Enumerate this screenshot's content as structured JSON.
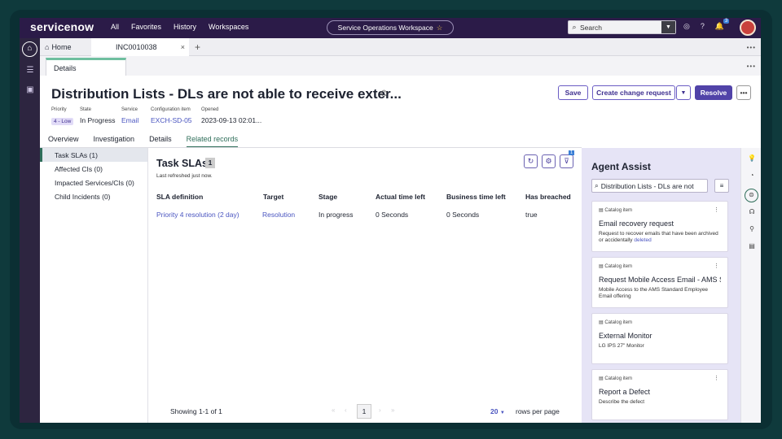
{
  "topbar": {
    "logo": "servicenow",
    "nav": [
      "All",
      "Favorites",
      "History",
      "Workspaces"
    ],
    "workspace": "Service Operations Workspace",
    "search_placeholder": "Search",
    "notification_count": "3"
  },
  "tabs": {
    "home": "Home",
    "record": "INC0010038"
  },
  "subtab": "Details",
  "record": {
    "title": "Distribution Lists - DLs are not able to receive exter...",
    "fields": {
      "priority_label": "Priority",
      "priority_value": "4 - Low",
      "state_label": "State",
      "state_value": "In Progress",
      "service_label": "Service",
      "service_value": "Email",
      "ci_label": "Configuration item",
      "ci_value": "EXCH-SD-05",
      "opened_label": "Opened",
      "opened_value": "2023-09-13 02:01..."
    },
    "buttons": {
      "save": "Save",
      "create_change": "Create change request",
      "resolve": "Resolve"
    },
    "tabs": [
      "Overview",
      "Investigation",
      "Details",
      "Related records"
    ]
  },
  "related_list": [
    "Task SLAs (1)",
    "Affected CIs (0)",
    "Impacted Services/CIs (0)",
    "Child Incidents (0)"
  ],
  "task_slas": {
    "title": "Task SLAs",
    "count": "1",
    "refreshed": "Last refreshed just now.",
    "filter_badge": "1",
    "columns": [
      "SLA definition",
      "Target",
      "Stage",
      "Actual time left",
      "Business time left",
      "Has breached"
    ],
    "rows": [
      [
        "Priority 4 resolution (2 day)",
        "Resolution",
        "In progress",
        "0 Seconds",
        "0 Seconds",
        "true"
      ]
    ],
    "pager": {
      "showing": "Showing 1-1 of 1",
      "page": "1",
      "per_page": "20",
      "per_page_label": "rows per page"
    }
  },
  "agent_assist": {
    "title": "Agent Assist",
    "search_value": "Distribution Lists - DLs are not",
    "cards": [
      {
        "type": "Catalog item",
        "title": "Email recovery request",
        "desc": "Request to recover emails that have been archived or accidentally ",
        "desc_hl": "deleted"
      },
      {
        "type": "Catalog item",
        "title": "Request Mobile Access Email - AMS S...",
        "desc": "Mobile Access to the AMS Standard Employee Email offering",
        "desc_hl": ""
      },
      {
        "type": "Catalog item",
        "title": "External Monitor",
        "desc": "LG IPS 27\" Monitor",
        "desc_hl": ""
      },
      {
        "type": "Catalog item",
        "title": "Report a Defect",
        "desc": "Describe the defect",
        "desc_hl": ""
      }
    ]
  },
  "colors": {
    "topbar": "#2b1b48",
    "primary_button": "#5143a8",
    "link": "#4a55c0",
    "active_tab": "#2f6e5a",
    "assist_bg": "#e6e4f6"
  }
}
